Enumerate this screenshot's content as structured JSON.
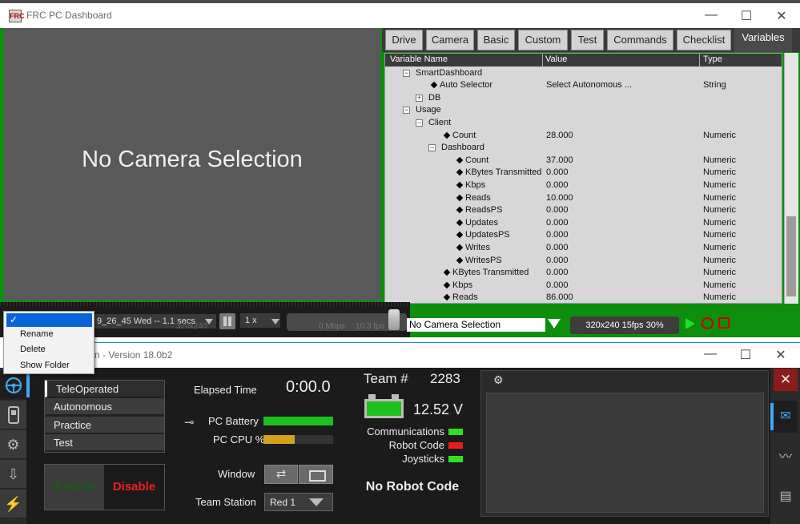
{
  "dashboard": {
    "window_title": "FRC PC Dashboard",
    "icon_text": "FRC",
    "window_controls": {
      "minimize": "—",
      "maximize": "☐",
      "close": "✕"
    },
    "camera_message": "No Camera Selection",
    "tabs": [
      "Drive",
      "Camera",
      "Basic",
      "Custom",
      "Test",
      "Commands",
      "Checklist",
      "Variables"
    ],
    "active_tab": "Variables",
    "tree": {
      "headers": {
        "name": "Variable Name",
        "value": "Value",
        "type": "Type"
      },
      "rows": [
        {
          "name": "SmartDashboard",
          "value": "",
          "type": "",
          "level": 0,
          "marker": "collapse"
        },
        {
          "name": "Auto Selector",
          "value": "Select Autonomous ...",
          "type": "String",
          "level": 1,
          "marker": "leaf"
        },
        {
          "name": "DB",
          "value": "",
          "type": "",
          "level": 1,
          "marker": "expand"
        },
        {
          "name": "Usage",
          "value": "",
          "type": "",
          "level": 0,
          "marker": "collapse"
        },
        {
          "name": "Client",
          "value": "",
          "type": "",
          "level": 1,
          "marker": "collapse"
        },
        {
          "name": "Count",
          "value": "28.000",
          "type": "Numeric",
          "level": 2,
          "marker": "leaf"
        },
        {
          "name": "Dashboard",
          "value": "",
          "type": "",
          "level": 2,
          "marker": "collapse"
        },
        {
          "name": "Count",
          "value": "37.000",
          "type": "Numeric",
          "level": 3,
          "marker": "leaf"
        },
        {
          "name": "KBytes Transmitted",
          "value": "0.000",
          "type": "Numeric",
          "level": 3,
          "marker": "leaf"
        },
        {
          "name": "Kbps",
          "value": "0.000",
          "type": "Numeric",
          "level": 3,
          "marker": "leaf"
        },
        {
          "name": "Reads",
          "value": "10.000",
          "type": "Numeric",
          "level": 3,
          "marker": "leaf"
        },
        {
          "name": "ReadsPS",
          "value": "0.000",
          "type": "Numeric",
          "level": 3,
          "marker": "leaf"
        },
        {
          "name": "Updates",
          "value": "0.000",
          "type": "Numeric",
          "level": 3,
          "marker": "leaf"
        },
        {
          "name": "UpdatesPS",
          "value": "0.000",
          "type": "Numeric",
          "level": 3,
          "marker": "leaf"
        },
        {
          "name": "Writes",
          "value": "0.000",
          "type": "Numeric",
          "level": 3,
          "marker": "leaf"
        },
        {
          "name": "WritesPS",
          "value": "0.000",
          "type": "Numeric",
          "level": 3,
          "marker": "leaf"
        },
        {
          "name": "KBytes Transmitted",
          "value": "0.000",
          "type": "Numeric",
          "level": 2,
          "marker": "leaf"
        },
        {
          "name": "Kbps",
          "value": "0.000",
          "type": "Numeric",
          "level": 2,
          "marker": "leaf"
        },
        {
          "name": "Reads",
          "value": "86.000",
          "type": "Numeric",
          "level": 2,
          "marker": "leaf"
        }
      ]
    },
    "camera_select_value": "No Camera Selection",
    "camera_info": "320x240   15fps   30%",
    "playback": {
      "file": "9_26_45 Wed -- 1.1 secs",
      "speed": "1 x",
      "dim": "320x240",
      "mbps": "0     Mbps",
      "fps": "10.3   fps"
    }
  },
  "context_menu": {
    "selected": "✓",
    "items": [
      "Rename",
      "Delete",
      "Show Folder"
    ]
  },
  "driver_station": {
    "window_title": "n - Version 18.0b2",
    "window_controls": {
      "minimize": "—",
      "maximize": "☐",
      "close": "✕"
    },
    "side_icons": [
      "steering-wheel",
      "diagnostics",
      "gear",
      "usb",
      "power"
    ],
    "modes": [
      "TeleOperated",
      "Autonomous",
      "Practice",
      "Test"
    ],
    "active_mode": "TeleOperated",
    "enable_label": "Enable",
    "disable_label": "Disable",
    "elapsed_label": "Elapsed Time",
    "elapsed_value": "0:00.0",
    "pc_battery_label": "PC Battery",
    "pc_battery_level": 1.0,
    "pc_cpu_label": "PC CPU %",
    "pc_cpu_level": 0.45,
    "window_label": "Window",
    "team_station_label": "Team Station",
    "team_station_value": "Red 1",
    "team_label": "Team #",
    "team_number": "2283",
    "voltage": "12.52 V",
    "indicators": [
      {
        "label": "Communications",
        "color": "#33dd22"
      },
      {
        "label": "Robot Code",
        "color": "#ee1b1b"
      },
      {
        "label": "Joysticks",
        "color": "#33dd22"
      }
    ],
    "no_robot_code": "No Robot Code",
    "close_symbol": "✕",
    "right_icons": [
      "mail-icon",
      "chart-icon",
      "layout-icon"
    ]
  }
}
